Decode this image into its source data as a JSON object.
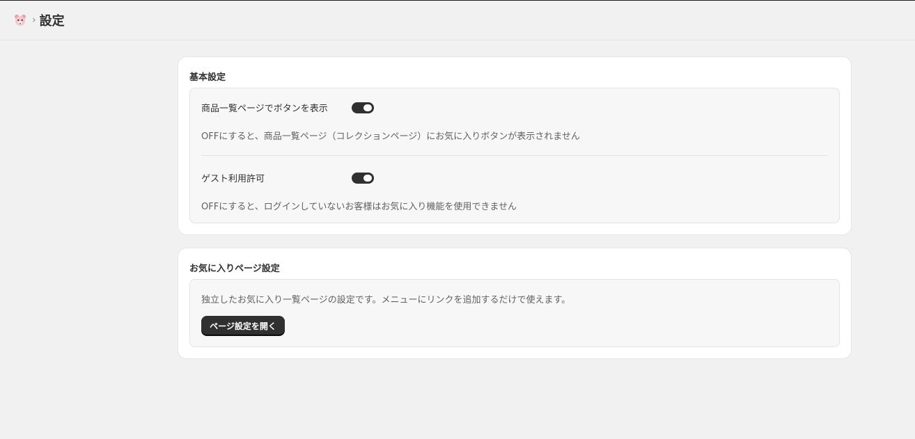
{
  "header": {
    "app_icon": "bear-app-icon",
    "separator": "›",
    "title": "設定"
  },
  "basic_settings": {
    "title": "基本設定",
    "settings": [
      {
        "label": "商品一覧ページでボタンを表示",
        "enabled": true,
        "description": "OFFにすると、商品一覧ページ（コレクションページ）にお気に入りボタンが表示されません"
      },
      {
        "label": "ゲスト利用許可",
        "enabled": true,
        "description": "OFFにすると、ログインしていないお客様はお気に入り機能を使用できません"
      }
    ]
  },
  "favorites_page": {
    "title": "お気に入りページ設定",
    "description": "独立したお気に入り一覧ページの設定です。メニューにリンクを追加するだけで使えます。",
    "button_label": "ページ設定を開く"
  },
  "colors": {
    "background": "#f1f1f1",
    "card": "#ffffff",
    "toggle_on": "#303030",
    "button": "#303030"
  }
}
